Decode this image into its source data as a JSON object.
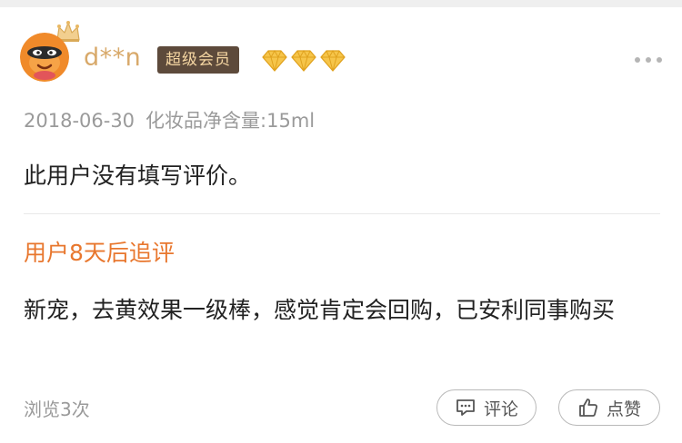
{
  "user": {
    "name": "d**n",
    "vip_label": "超级会员",
    "diamond_count": 3,
    "avatar_icon": "fox-avatar-icon",
    "crown_icon": "crown-icon"
  },
  "review": {
    "date": "2018-06-30",
    "spec": "化妆品净含量:15ml",
    "text": "此用户没有填写评价。"
  },
  "followup": {
    "title": "用户8天后追评",
    "text": "新宠，去黄效果一级棒，感觉肯定会回购，已安利同事购买"
  },
  "footer": {
    "views": "浏览3次",
    "comment_label": "评论",
    "like_label": "点赞"
  },
  "colors": {
    "accent_orange": "#e8772e",
    "username_gold": "#d8a96a",
    "vip_bg": "#5d4a3b",
    "vip_text": "#f6d7a3",
    "meta_gray": "#9a9a9a"
  }
}
